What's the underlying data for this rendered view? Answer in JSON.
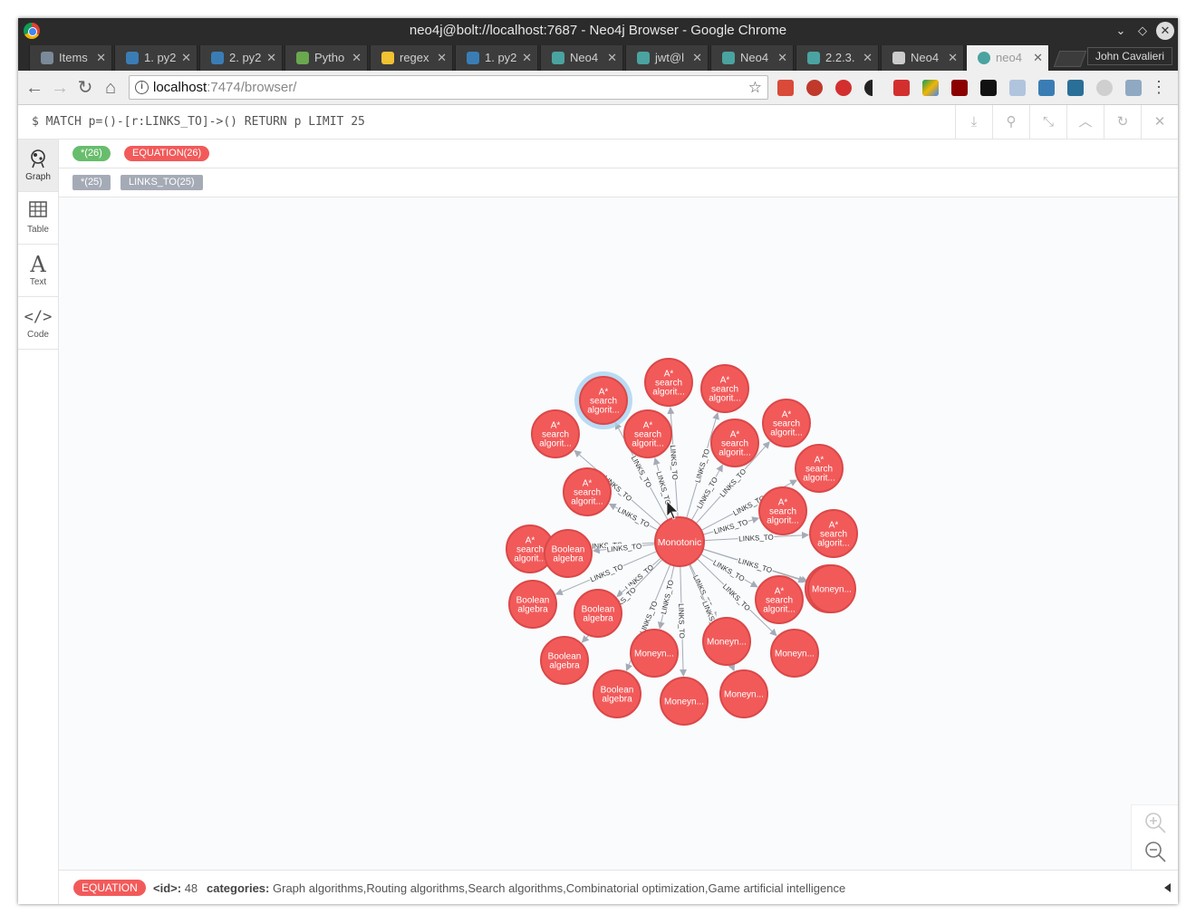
{
  "window": {
    "title": "neo4j@bolt://localhost:7687 - Neo4j Browser - Google Chrome",
    "controls": {
      "minimize": "⌄",
      "maximize": "◇",
      "close": "✕"
    }
  },
  "tabs": [
    {
      "label": "Items",
      "close": "✕"
    },
    {
      "label": "1. py2",
      "close": "✕"
    },
    {
      "label": "2. py2",
      "close": "✕"
    },
    {
      "label": "Pytho",
      "close": "✕"
    },
    {
      "label": "regex",
      "close": "✕"
    },
    {
      "label": "1. py2",
      "close": "✕"
    },
    {
      "label": "Neo4",
      "close": "✕"
    },
    {
      "label": "jwt@l",
      "close": "✕"
    },
    {
      "label": "Neo4",
      "close": "✕"
    },
    {
      "label": "2.2.3.",
      "close": "✕"
    },
    {
      "label": "Neo4",
      "close": "✕"
    },
    {
      "label": "neo4",
      "close": "✕"
    }
  ],
  "profile_name": "John Cavalieri",
  "address": {
    "host": "localhost",
    "path": ":7474/browser/"
  },
  "query": "$ MATCH p=()-[r:LINKS_TO]->() RETURN p LIMIT 25",
  "sidebar": [
    {
      "label": "Graph",
      "icon": "graph-icon"
    },
    {
      "label": "Table",
      "icon": "table-icon"
    },
    {
      "label": "Text",
      "icon": "text-icon"
    },
    {
      "label": "Code",
      "icon": "code-icon"
    }
  ],
  "legend": {
    "labels": [
      {
        "text": "*(26)",
        "color": "#68bd6d"
      },
      {
        "text": "EQUATION(26)",
        "color": "#f25a5a"
      }
    ],
    "relationships": [
      {
        "text": "*(25)",
        "color": "#a5abb6"
      },
      {
        "text": "LINKS_TO(25)",
        "color": "#a5abb6"
      }
    ]
  },
  "graph": {
    "node_color": "#f25a5a",
    "node_border": "#da4848",
    "edge_color": "#a5abb6",
    "selected_halo": "#a9d3f0",
    "rel_type": "LINKS_TO",
    "center": {
      "label": "Monotonic"
    },
    "nodes": [
      {
        "lines": [
          "A*",
          "search",
          "algorit..."
        ],
        "selected": true
      },
      {
        "lines": [
          "A*",
          "search",
          "algorit..."
        ]
      },
      {
        "lines": [
          "A*",
          "search",
          "algorit..."
        ]
      },
      {
        "lines": [
          "A*",
          "search",
          "algorit..."
        ]
      },
      {
        "lines": [
          "A*",
          "search",
          "algorit..."
        ]
      },
      {
        "lines": [
          "A*",
          "search",
          "algorit..."
        ]
      },
      {
        "lines": [
          "A*",
          "search",
          "algorit..."
        ]
      },
      {
        "lines": [
          "A*",
          "search",
          "algorit..."
        ]
      },
      {
        "lines": [
          "A*",
          "search",
          "algorit..."
        ]
      },
      {
        "lines": [
          "A*",
          "search",
          "algorit..."
        ]
      },
      {
        "lines": [
          "A*",
          "search",
          "algorit..."
        ]
      },
      {
        "lines": [
          "A*",
          "search",
          "algorit..."
        ]
      },
      {
        "lines": [
          "A*",
          "search",
          "algorit..."
        ]
      },
      {
        "lines": [
          "Boolean",
          "algebra"
        ]
      },
      {
        "lines": [
          "Boolean",
          "algebra"
        ]
      },
      {
        "lines": [
          "Boolean",
          "algebra"
        ]
      },
      {
        "lines": [
          "Boolean",
          "algebra"
        ]
      },
      {
        "lines": [
          "Boolean",
          "algebra"
        ]
      },
      {
        "lines": [
          "Moneyn..."
        ]
      },
      {
        "lines": [
          "Moneyn..."
        ]
      },
      {
        "lines": [
          "Moneyn..."
        ]
      },
      {
        "lines": [
          "Moneyn..."
        ]
      },
      {
        "lines": [
          "Moneyn..."
        ]
      },
      {
        "lines": [
          "Moneyn..."
        ]
      },
      {
        "lines": [
          "A*",
          "search",
          "algorit..."
        ]
      }
    ]
  },
  "zoom": {
    "in": "+",
    "out": "−"
  },
  "status": {
    "badge": "EQUATION",
    "id_key": "<id>:",
    "id_value": "48",
    "categories_key": "categories:",
    "categories_value": "Graph algorithms,Routing algorithms,Search algorithms,Combinatorial optimization,Game artificial intelligence"
  }
}
